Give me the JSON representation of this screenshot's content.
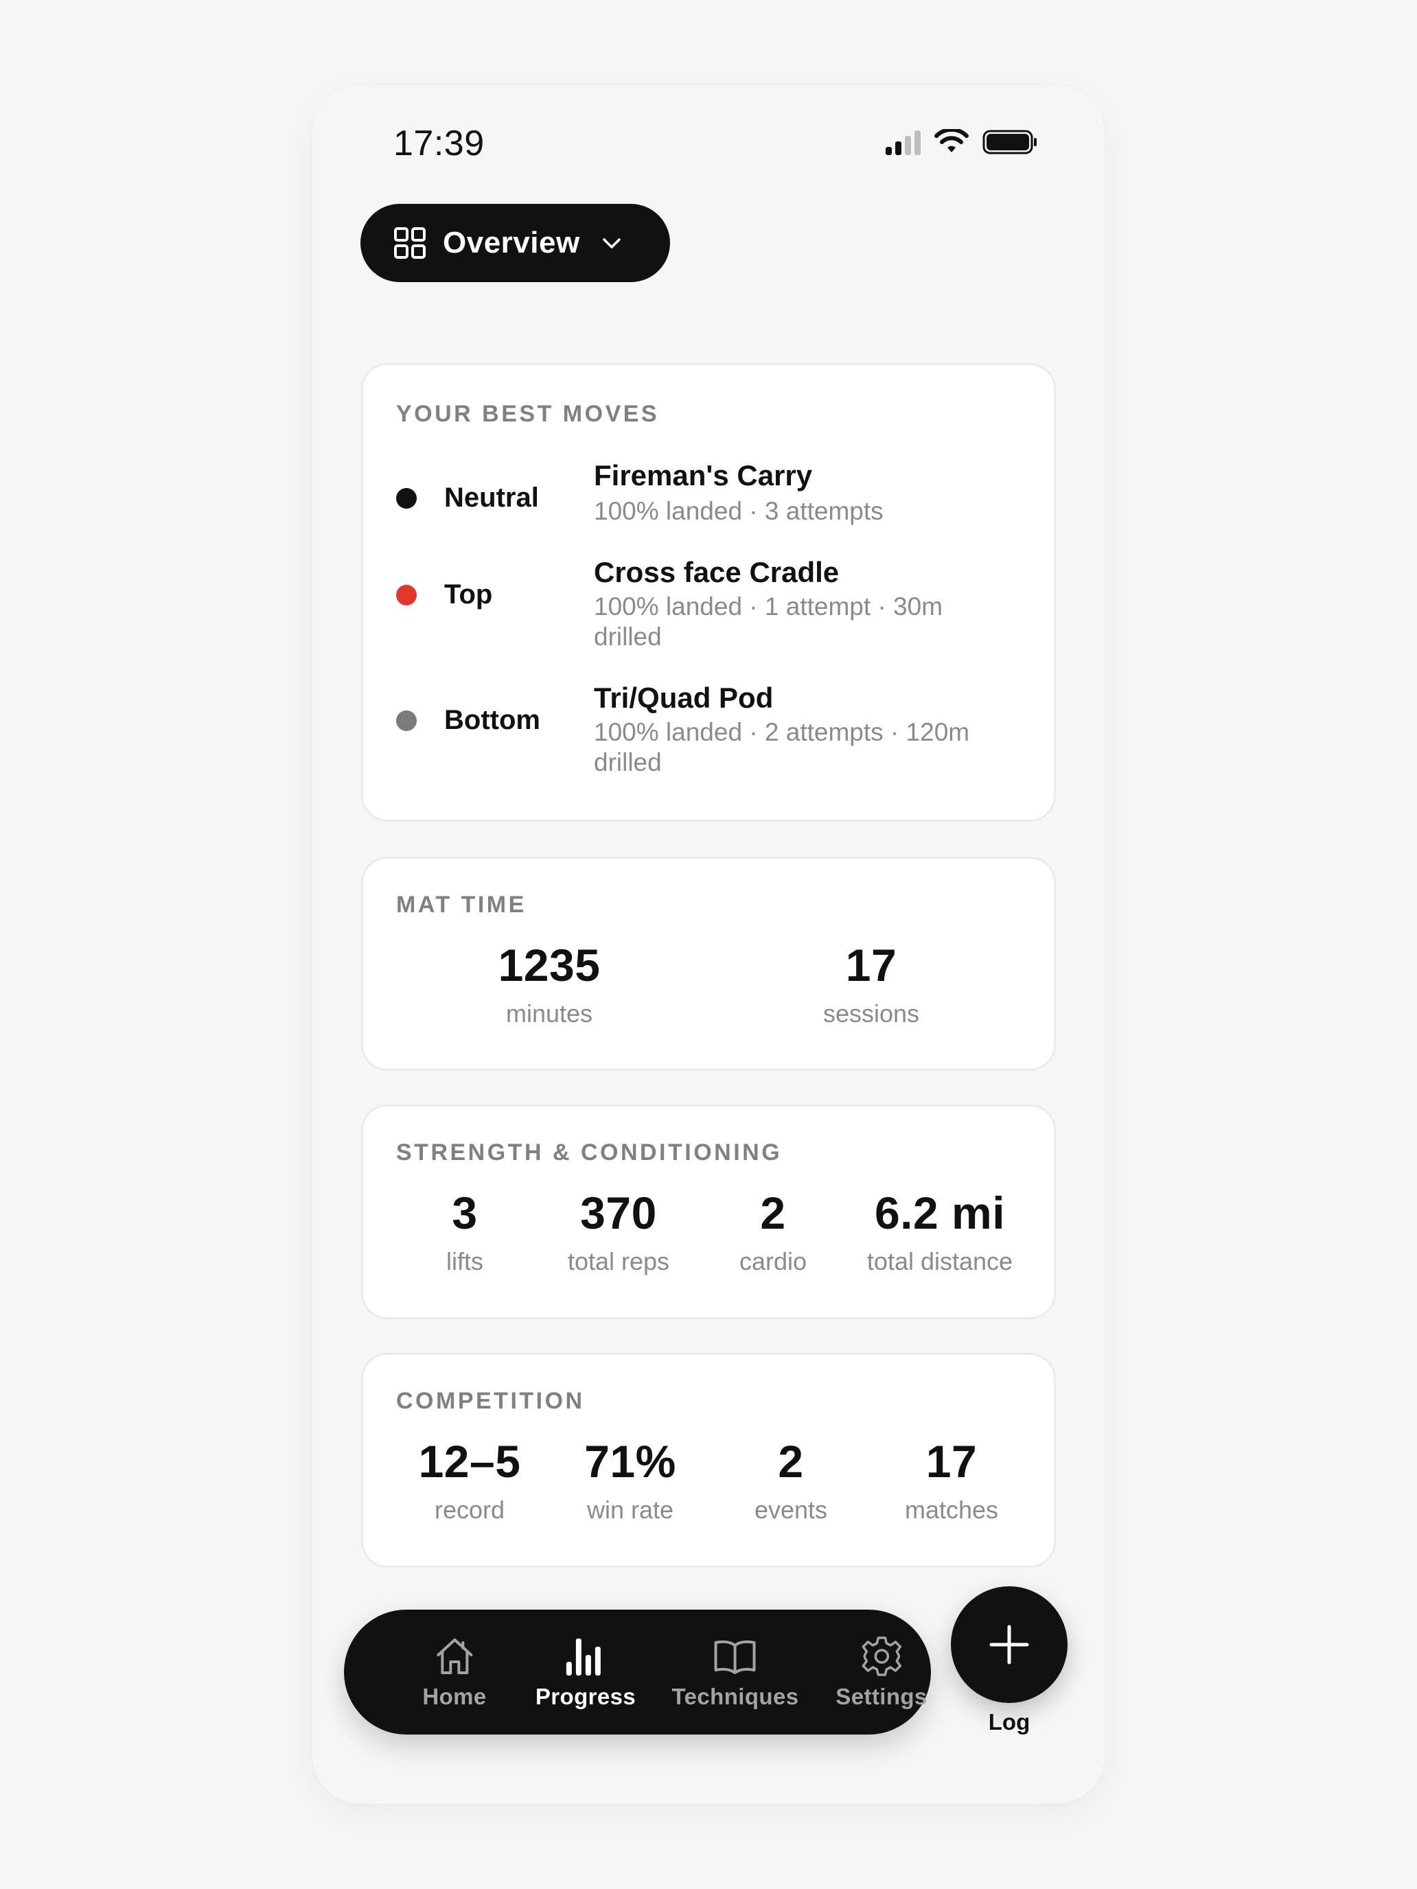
{
  "status_bar": {
    "time": "17:39"
  },
  "header": {
    "view_label": "Overview"
  },
  "best_moves": {
    "title": "YOUR BEST MOVES",
    "items": [
      {
        "position": "Neutral",
        "dot_color": "#111111",
        "move": "Fireman's Carry",
        "detail": "100% landed · 3 attempts"
      },
      {
        "position": "Top",
        "dot_color": "#e0382b",
        "move": "Cross face Cradle",
        "detail": "100% landed · 1 attempt · 30m drilled"
      },
      {
        "position": "Bottom",
        "dot_color": "#7a7a7a",
        "move": "Tri/Quad Pod",
        "detail": "100% landed · 2 attempts · 120m drilled"
      }
    ]
  },
  "mat_time": {
    "title": "MAT TIME",
    "stats": [
      {
        "value": "1235",
        "label": "minutes"
      },
      {
        "value": "17",
        "label": "sessions"
      }
    ]
  },
  "strength": {
    "title": "STRENGTH & CONDITIONING",
    "stats": [
      {
        "value": "3",
        "label": "lifts"
      },
      {
        "value": "370",
        "label": "total reps"
      },
      {
        "value": "2",
        "label": "cardio"
      },
      {
        "value": "6.2 mi",
        "label": "total distance"
      }
    ]
  },
  "competition": {
    "title": "COMPETITION",
    "stats": [
      {
        "value": "12–5",
        "label": "record"
      },
      {
        "value": "71%",
        "label": "win rate"
      },
      {
        "value": "2",
        "label": "events"
      },
      {
        "value": "17",
        "label": "matches"
      }
    ]
  },
  "nav": {
    "tabs": [
      {
        "label": "Home",
        "icon": "home-icon",
        "active": false
      },
      {
        "label": "Progress",
        "icon": "bar-chart-icon",
        "active": true
      },
      {
        "label": "Techniques",
        "icon": "book-icon",
        "active": false
      },
      {
        "label": "Settings",
        "icon": "gear-icon",
        "active": false
      }
    ],
    "log_label": "Log",
    "active_color": "#ffffff",
    "inactive_color": "#a3a3a3"
  }
}
